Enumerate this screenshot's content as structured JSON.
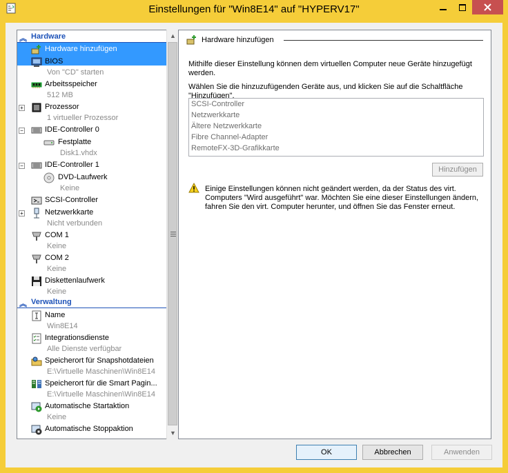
{
  "window": {
    "title": "Einstellungen für \"Win8E14\" auf \"HYPERV17\"",
    "accent_color": "#f5cd39",
    "close_button_color": "#c75050"
  },
  "tree": {
    "hardware_section": "Hardware",
    "management_section": "Verwaltung",
    "hardware_items": [
      {
        "label": "Hardware hinzufügen",
        "sub": "",
        "icon": "add-hardware-icon",
        "selected": true
      },
      {
        "label": "BIOS",
        "sub": "Von \"CD\" starten",
        "icon": "bios-icon"
      },
      {
        "label": "Arbeitsspeicher",
        "sub": "512 MB",
        "icon": "memory-icon"
      },
      {
        "label": "Prozessor",
        "sub": "1 virtueller Prozessor",
        "icon": "processor-icon",
        "expander": "+"
      },
      {
        "label": "IDE-Controller 0",
        "sub": "",
        "icon": "ide-controller-icon",
        "expander": "−"
      },
      {
        "label": "Festplatte",
        "sub": "Disk1.vhdx",
        "icon": "hard-disk-icon"
      },
      {
        "label": "IDE-Controller 1",
        "sub": "",
        "icon": "ide-controller-icon",
        "expander": "−"
      },
      {
        "label": "DVD-Laufwerk",
        "sub": "Keine",
        "icon": "dvd-drive-icon"
      },
      {
        "label": "SCSI-Controller",
        "sub": "",
        "icon": "scsi-controller-icon"
      },
      {
        "label": "Netzwerkkarte",
        "sub": "Nicht verbunden",
        "icon": "network-adapter-icon",
        "expander": "+"
      },
      {
        "label": "COM 1",
        "sub": "Keine",
        "icon": "com-port-icon"
      },
      {
        "label": "COM 2",
        "sub": "Keine",
        "icon": "com-port-icon"
      },
      {
        "label": "Diskettenlaufwerk",
        "sub": "Keine",
        "icon": "floppy-drive-icon"
      }
    ],
    "management_items": [
      {
        "label": "Name",
        "sub": "Win8E14",
        "icon": "name-icon"
      },
      {
        "label": "Integrationsdienste",
        "sub": "Alle Dienste verfügbar",
        "icon": "integration-services-icon"
      },
      {
        "label": "Speicherort für Snapshotdateien",
        "sub": "E:\\Virtuelle Maschinen\\Win8E14",
        "icon": "snapshot-location-icon"
      },
      {
        "label": "Speicherort für die Smart Pagin...",
        "sub": "E:\\Virtuelle Maschinen\\Win8E14",
        "icon": "smart-paging-icon"
      },
      {
        "label": "Automatische Startaktion",
        "sub": "Keine",
        "icon": "auto-start-icon"
      },
      {
        "label": "Automatische Stoppaktion",
        "sub": "",
        "icon": "auto-stop-icon"
      }
    ]
  },
  "panel": {
    "title": "Hardware hinzufügen",
    "description": "Mithilfe dieser Einstellung können dem virtuellen Computer neue Geräte hinzugefügt werden.",
    "instruction": "Wählen Sie die hinzuzufügenden Geräte aus, und klicken Sie auf die Schaltfläche \"Hinzufügen\".",
    "devices": [
      "SCSI-Controller",
      "Netzwerkkarte",
      "Ältere Netzwerkkarte",
      "Fibre Channel-Adapter",
      "RemoteFX-3D-Grafikkarte"
    ],
    "add_button": "Hinzufügen",
    "warning": "Einige Einstellungen können nicht geändert werden, da der Status des virt. Computers \"Wird ausgeführt\" war. Möchten Sie eine dieser Einstellungen ändern, fahren Sie den virt. Computer herunter, und öffnen Sie das Fenster erneut."
  },
  "buttons": {
    "ok": "OK",
    "cancel": "Abbrechen",
    "apply": "Anwenden"
  }
}
